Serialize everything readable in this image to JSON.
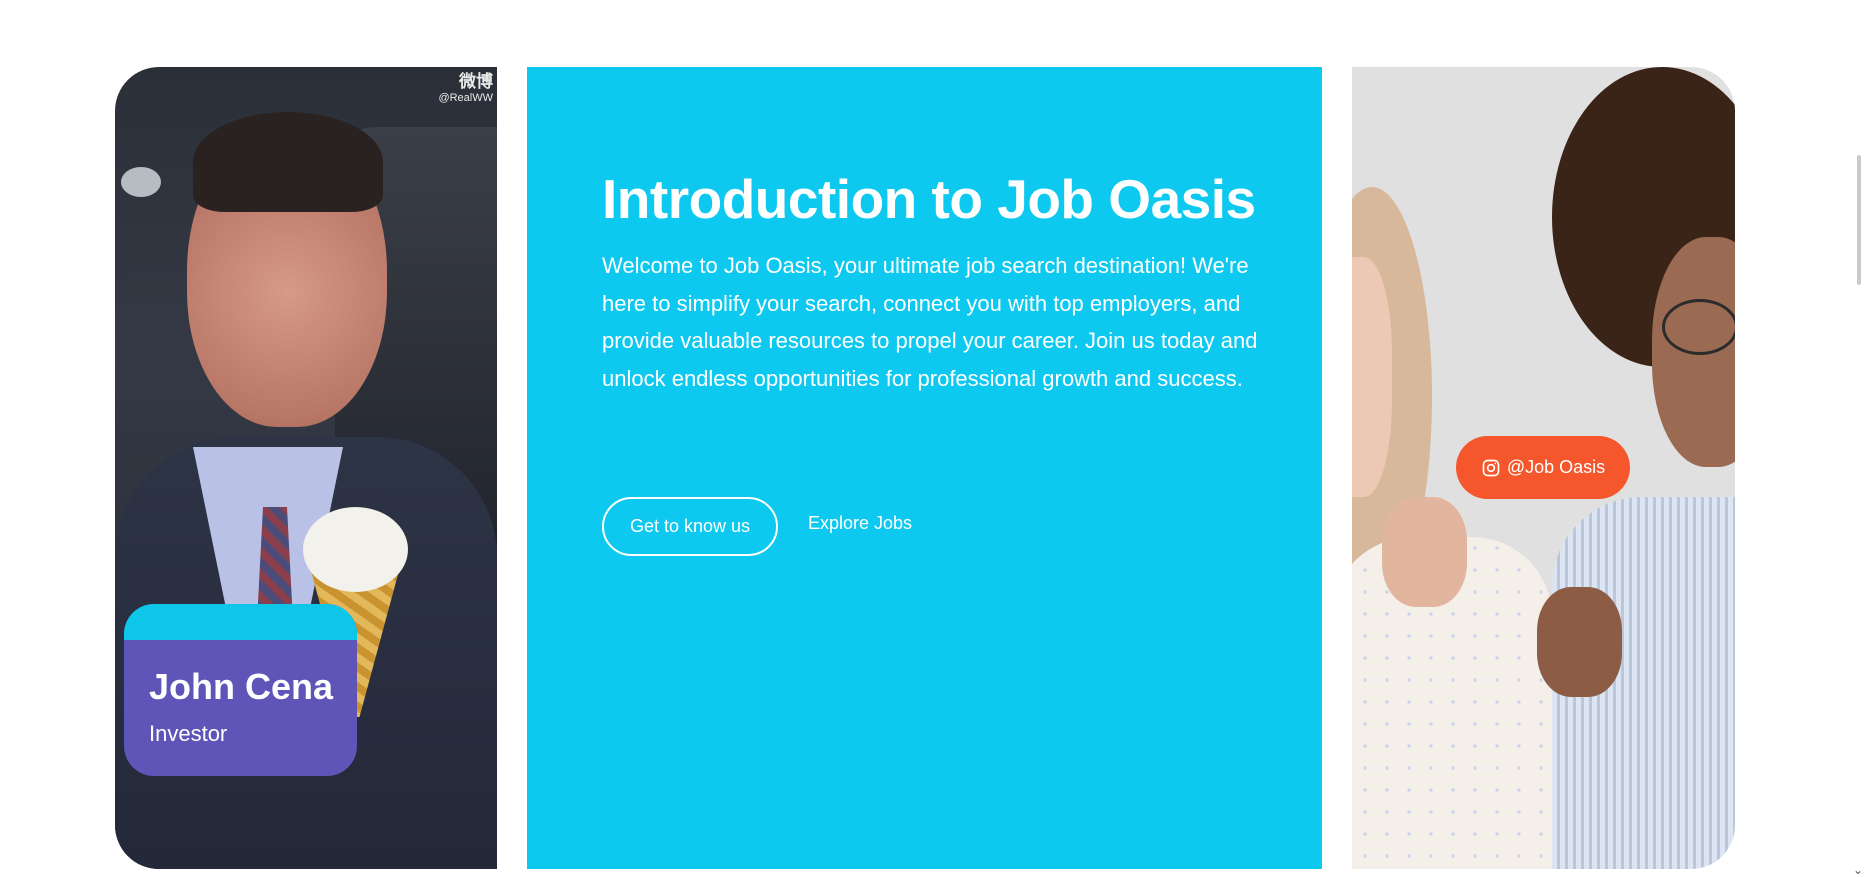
{
  "left_card": {
    "watermark_top": "微博",
    "watermark_handle": "@RealWW",
    "person_name": "John Cena",
    "person_role": "Investor"
  },
  "intro": {
    "title": "Introduction to Job Oasis",
    "text": "Welcome to Job Oasis, your ultimate job search destination! We're here to simplify your search, connect you with top employers, and provide valuable resources to propel your career. Join us today and unlock endless opportunities for professional growth and success.",
    "primary_button": "Get to know us",
    "secondary_link": "Explore Jobs"
  },
  "right_card": {
    "instagram_handle": "@Job Oasis",
    "icon": "instagram-icon"
  },
  "colors": {
    "panel_blue": "#0ec9ef",
    "name_card_purple": "#5f54b8",
    "badge_orange": "#f5562b"
  }
}
